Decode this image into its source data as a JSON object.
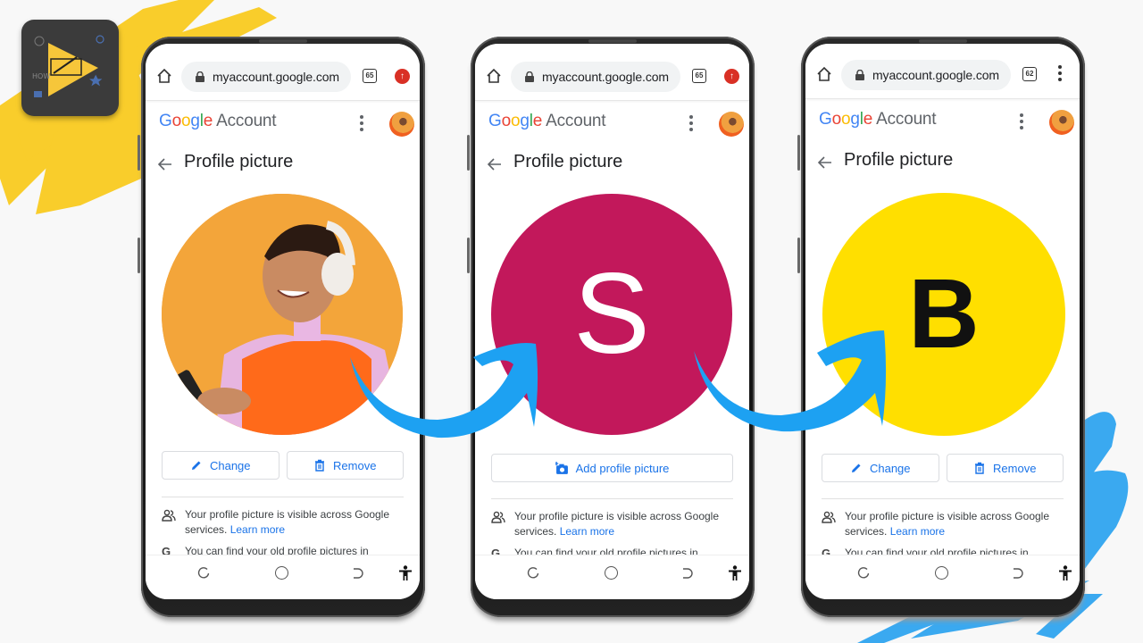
{
  "logo": {
    "name": "how-to tutorial channel logo",
    "label": "HOW"
  },
  "colors": {
    "accent_blue": "#1a73e8",
    "arrow_blue": "#1da1f2",
    "brush_yellow": "#f9cd2b",
    "initial_s_bg": "#c2185b",
    "initial_b_bg": "#ffdf00"
  },
  "phones": [
    {
      "browser": {
        "url": "myaccount.google.com",
        "tab_count": "65",
        "right_icon": "extension-icon"
      },
      "header": {
        "brand": [
          "G",
          "o",
          "o",
          "g",
          "l",
          "e"
        ],
        "product": "Account"
      },
      "page_title": "Profile picture",
      "picture": {
        "type": "photo",
        "description": "woman with headphones on orange background"
      },
      "buttons": [
        {
          "label": "Change",
          "icon": "pencil-icon"
        },
        {
          "label": "Remove",
          "icon": "trash-icon"
        }
      ],
      "info": {
        "text": "Your profile picture is visible across Google services.",
        "link": "Learn more"
      },
      "info2": "You can find your old profile pictures in"
    },
    {
      "browser": {
        "url": "myaccount.google.com",
        "tab_count": "65",
        "right_icon": "extension-icon"
      },
      "header": {
        "brand": [
          "G",
          "o",
          "o",
          "g",
          "l",
          "e"
        ],
        "product": "Account"
      },
      "page_title": "Profile picture",
      "picture": {
        "type": "initial",
        "letter": "S",
        "bg": "#c2185b",
        "fg": "#ffffff"
      },
      "buttons": [
        {
          "label": "Add profile picture",
          "icon": "add-photo-icon"
        }
      ],
      "info": {
        "text": "Your profile picture is visible across Google services.",
        "link": "Learn more"
      },
      "info2": "You can find your old profile pictures in"
    },
    {
      "browser": {
        "url": "myaccount.google.com",
        "tab_count": "62",
        "right_icon": "menu-icon"
      },
      "header": {
        "brand": [
          "G",
          "o",
          "o",
          "g",
          "l",
          "e"
        ],
        "product": "Account"
      },
      "page_title": "Profile picture",
      "picture": {
        "type": "initial",
        "letter": "B",
        "bg": "#ffdf00",
        "fg": "#111111"
      },
      "buttons": [
        {
          "label": "Change",
          "icon": "pencil-icon"
        },
        {
          "label": "Remove",
          "icon": "trash-icon"
        }
      ],
      "info": {
        "text": "Your profile picture is visible across Google services.",
        "link": "Learn more"
      },
      "info2": "You can find your old profile pictures in"
    }
  ]
}
